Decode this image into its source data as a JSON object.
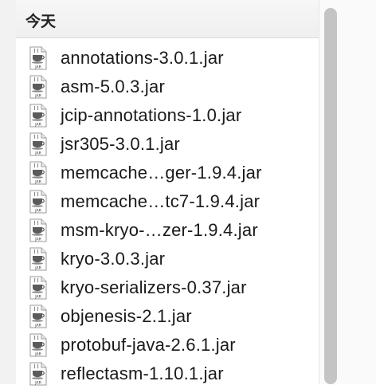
{
  "section": {
    "title": "今天"
  },
  "files": [
    {
      "name": "annotations-3.0.1.jar",
      "icon": "jar-file-icon"
    },
    {
      "name": "asm-5.0.3.jar",
      "icon": "jar-file-icon"
    },
    {
      "name": "jcip-annotations-1.0.jar",
      "icon": "jar-file-icon"
    },
    {
      "name": "jsr305-3.0.1.jar",
      "icon": "jar-file-icon"
    },
    {
      "name": "memcache…ger-1.9.4.jar",
      "icon": "jar-file-icon"
    },
    {
      "name": "memcache…tc7-1.9.4.jar",
      "icon": "jar-file-icon"
    },
    {
      "name": "msm-kryo-…zer-1.9.4.jar",
      "icon": "jar-file-icon"
    },
    {
      "name": "kryo-3.0.3.jar",
      "icon": "jar-file-icon"
    },
    {
      "name": "kryo-serializers-0.37.jar",
      "icon": "jar-file-icon"
    },
    {
      "name": "objenesis-2.1.jar",
      "icon": "jar-file-icon"
    },
    {
      "name": "protobuf-java-2.6.1.jar",
      "icon": "jar-file-icon"
    },
    {
      "name": "reflectasm-1.10.1.jar",
      "icon": "jar-file-icon"
    }
  ],
  "icon_label": "JAR",
  "colors": {
    "header_bg": "#f2f2f2",
    "scrollbar": "#c4c4c4",
    "text": "#1a1a1a"
  }
}
